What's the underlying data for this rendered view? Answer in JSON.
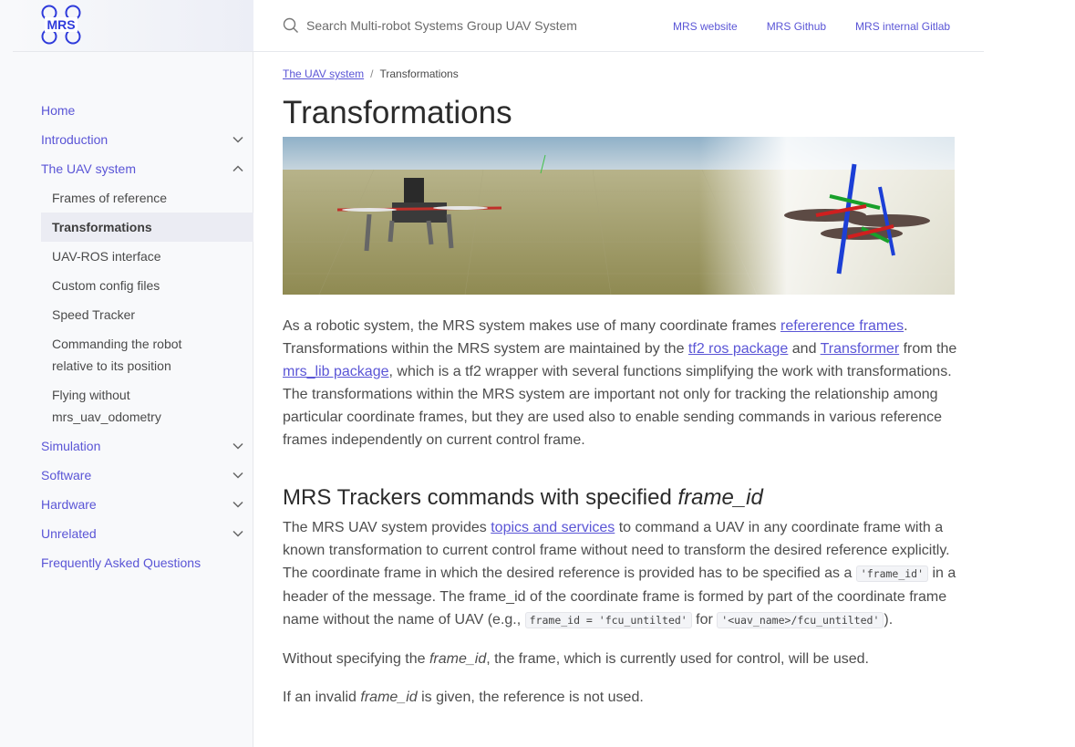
{
  "logo": {
    "text": "MRS",
    "icon": "mrs-quadrotor-logo",
    "color": "#2f3bdb"
  },
  "search": {
    "placeholder": "Search Multi-robot Systems Group UAV System",
    "value": ""
  },
  "top_links": [
    "MRS website",
    "MRS Github",
    "MRS internal Gitlab"
  ],
  "sidebar": {
    "items": [
      {
        "label": "Home",
        "expandable": false
      },
      {
        "label": "Introduction",
        "expandable": true,
        "expanded": false
      },
      {
        "label": "The UAV system",
        "expandable": true,
        "expanded": true
      },
      {
        "label": "Simulation",
        "expandable": true,
        "expanded": false
      },
      {
        "label": "Software",
        "expandable": true,
        "expanded": false
      },
      {
        "label": "Hardware",
        "expandable": true,
        "expanded": false
      },
      {
        "label": "Unrelated",
        "expandable": true,
        "expanded": false
      },
      {
        "label": "Frequently Asked Questions",
        "expandable": false
      }
    ],
    "subitems": [
      {
        "line1": "Frames of reference"
      },
      {
        "line1": "Transformations",
        "active": true
      },
      {
        "line1": "UAV-ROS interface"
      },
      {
        "line1": "Custom config files"
      },
      {
        "line1": "Speed Tracker"
      },
      {
        "line1": "Commanding the robot",
        "line2": "relative to its position"
      },
      {
        "line1": "Flying without",
        "line2": "mrs_uav_odometry"
      }
    ]
  },
  "breadcrumb": {
    "parent": "The UAV system",
    "separator": "/",
    "current": "Transformations"
  },
  "page_title": "Transformations",
  "intro": {
    "t1": "As a robotic system, the MRS system makes use of many coordinate frames ",
    "link1": "refererence frames",
    "t2": ". Transformations within the MRS system are maintained by the ",
    "link2": "tf2 ros package",
    "t3": " and ",
    "link3": "Transformer",
    "t4": " from the ",
    "link4": "mrs_lib package",
    "t5": ", which is a tf2 wrapper with several functions simplifying the work with transformations. The transformations within the MRS system are important not only for tracking the relationship among particular coordinate frames, but they are used also to enable sending commands in various reference frames independently on current control frame."
  },
  "section": {
    "heading_prefix": "MRS Trackers commands with specified ",
    "heading_em": "frame_id",
    "p1": {
      "t1": "The MRS UAV system provides ",
      "link": "topics and services",
      "t2": " to command a UAV in any coordinate frame with a known transformation to current control frame without need to transform the desired reference explicitly. The coordinate frame in which the desired reference is provided has to be specified as a ",
      "code1": "'frame_id'",
      "t3": " in a header of the message. The frame_id of the coordinate frame is formed by part of the coordinate frame name without the name of UAV (e.g., ",
      "code2": "frame_id = 'fcu_untilted'",
      "t4": " for ",
      "code3": "'<uav_name>/fcu_untilted'",
      "t5": ")."
    },
    "p2": {
      "t1": "Without specifying the ",
      "em": "frame_id",
      "t2": ", the frame, which is currently used for control, will be used."
    },
    "p3": {
      "t1": "If an invalid ",
      "em": "frame_id",
      "t2": " is given, the reference is not used."
    }
  },
  "colors": {
    "accent": "#5a55d6",
    "sidebar_bg": "#f8f9fb",
    "active_bg": "#ebecf3",
    "text": "#4d4d4d"
  }
}
